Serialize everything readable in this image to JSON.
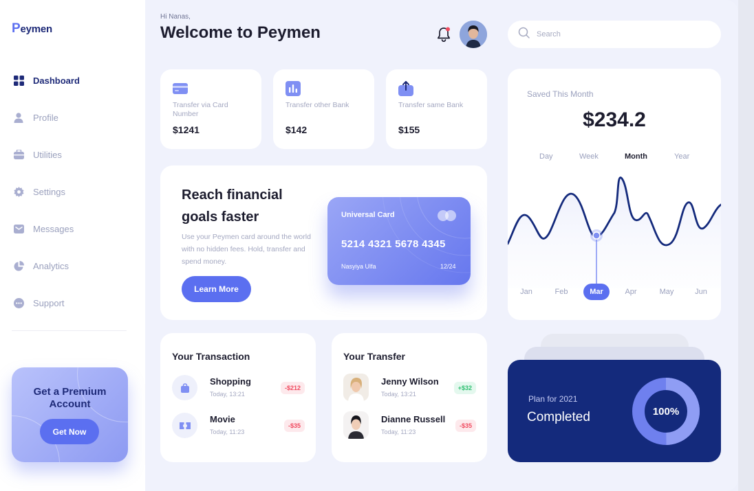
{
  "brand": {
    "logo_initial": "P",
    "logo_rest": "eymen"
  },
  "sidebar": {
    "items": [
      {
        "label": "Dashboard",
        "icon": "grid-icon",
        "active": true
      },
      {
        "label": "Profile",
        "icon": "user-icon"
      },
      {
        "label": "Utilities",
        "icon": "briefcase-icon"
      },
      {
        "label": "Settings",
        "icon": "gear-icon"
      },
      {
        "label": "Messages",
        "icon": "mail-icon"
      },
      {
        "label": "Analytics",
        "icon": "pie-chart-icon"
      },
      {
        "label": "Support",
        "icon": "chat-bubble-icon"
      }
    ],
    "premium": {
      "title": "Get a Premium Account",
      "button": "Get Now"
    }
  },
  "header": {
    "greeting": "Hi Nanas,",
    "title": "Welcome to Peymen",
    "search_placeholder": "Search",
    "has_notification": true
  },
  "transfers": [
    {
      "label": "Transfer via Card Number",
      "value": "$1241",
      "icon": "card-icon"
    },
    {
      "label": "Transfer other Bank",
      "value": "$142",
      "icon": "bar-chart-icon"
    },
    {
      "label": "Transfer same Bank",
      "value": "$155",
      "icon": "upload-icon"
    }
  ],
  "promo": {
    "title": "Reach financial goals faster",
    "text": "Use your Peymen card around the world with no hidden fees. Hold, transfer and spend money.",
    "button": "Learn More",
    "card": {
      "name": "Universal Card",
      "number": "5214 4321 5678 4345",
      "holder": "Nasyiya Ulfa",
      "expiry": "12/24"
    }
  },
  "saved": {
    "title": "Saved This Month",
    "amount": "$234.2",
    "periods": [
      "Day",
      "Week",
      "Month",
      "Year"
    ],
    "active_period": "Month",
    "months": [
      "Jan",
      "Feb",
      "Mar",
      "Apr",
      "May",
      "Jun"
    ],
    "active_month": "Mar"
  },
  "transactions": {
    "title": "Your Transaction",
    "items": [
      {
        "name": "Shopping",
        "time": "Today, 13:21",
        "amount": "-$212",
        "icon": "shopping-bag-icon"
      },
      {
        "name": "Movie",
        "time": "Today, 11:23",
        "amount": "-$35",
        "icon": "ticket-icon"
      }
    ]
  },
  "transfers_list": {
    "title": "Your Transfer",
    "items": [
      {
        "name": "Jenny Wilson",
        "time": "Today, 13:21",
        "amount": "+$32",
        "type": "pos"
      },
      {
        "name": "Dianne Russell",
        "time": "Today, 11:23",
        "amount": "-$35",
        "type": "neg"
      }
    ]
  },
  "plan": {
    "label": "Plan for 2021",
    "status": "Completed",
    "percent": "100%"
  },
  "colors": {
    "accent": "#5b6ff0",
    "navy": "#142a7c",
    "positive": "#2fbf71",
    "negative": "#f04a5f"
  }
}
